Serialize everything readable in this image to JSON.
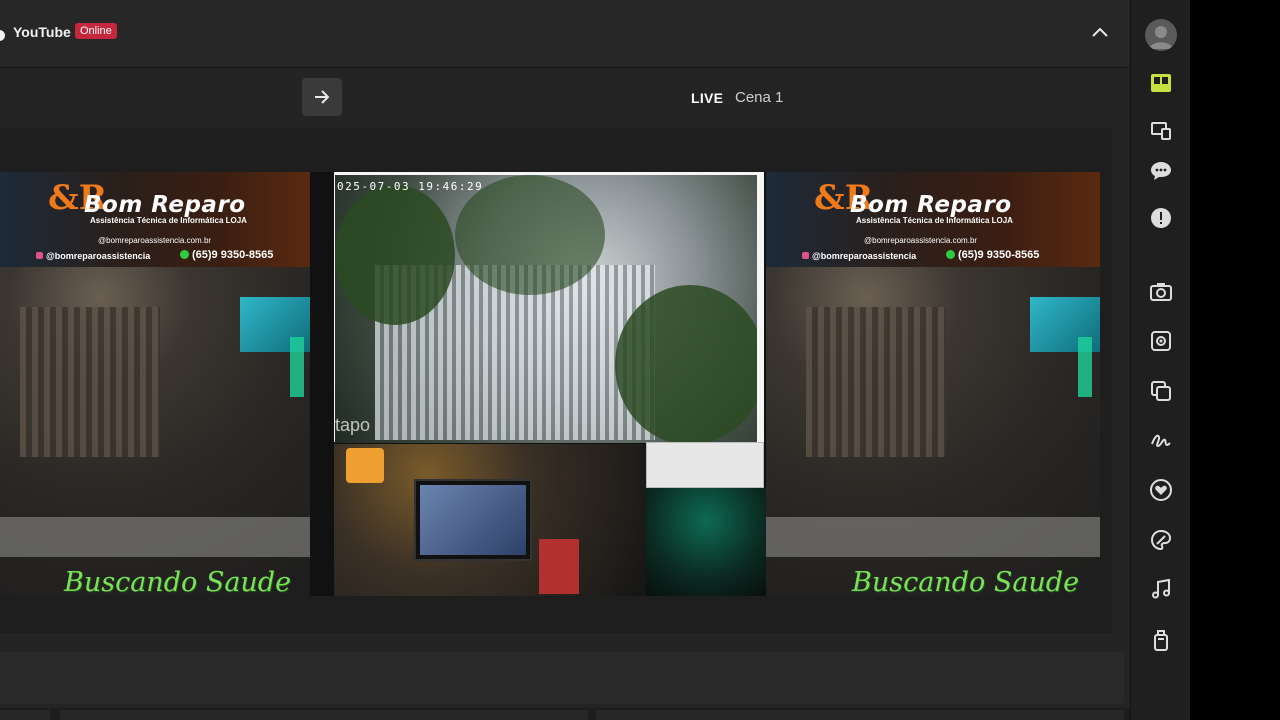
{
  "header": {
    "platform_name": "YouTube",
    "status_badge": "Online"
  },
  "toolbar": {
    "live_label": "LIVE",
    "scene_name": "Cena 1"
  },
  "sources": {
    "banner": {
      "logo_mark": "&R",
      "title": "Bom Reparo",
      "subtitle": "Assistência Técnica de Informática LOJA",
      "website": "@bomreparoassistencia.com.br",
      "instagram": "@bomreparoassistencia",
      "phone": "(65)9 9350-8565"
    },
    "overlay_text": "Buscando Saude",
    "camera": {
      "timestamp": "025-07-03 19:46:29",
      "brand": "tapo"
    }
  },
  "rail": {
    "icons": [
      "layout-grid-icon",
      "devices-icon",
      "chat-icon",
      "alert-icon",
      "camera-icon",
      "webcam-icon",
      "layers-icon",
      "signature-icon",
      "heart-badge-icon",
      "palette-icon",
      "music-note-icon",
      "device-icon"
    ]
  },
  "colors": {
    "accent_active": "#c6e040",
    "badge_online": "#c5283d",
    "overlay_green": "#7de05a",
    "banner_orange": "#f07a1a"
  }
}
